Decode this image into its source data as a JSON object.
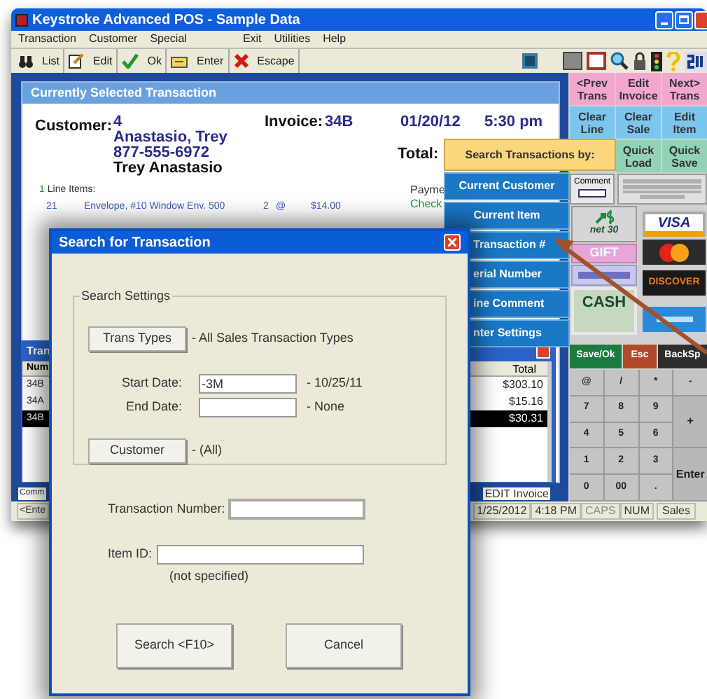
{
  "main_window": {
    "title": "Keystroke Advanced POS - Sample Data",
    "menu_left": [
      "Transaction",
      "Customer",
      "Special"
    ],
    "menu_right": [
      "Exit",
      "Utilities",
      "Help"
    ],
    "toolbar": [
      {
        "label": "List",
        "kind": "binoculars"
      },
      {
        "label": "Edit",
        "kind": "edit"
      },
      {
        "label": "Ok",
        "kind": "check"
      },
      {
        "label": "Enter",
        "kind": "enter"
      },
      {
        "label": "Escape",
        "kind": "cross"
      }
    ]
  },
  "current_transaction": {
    "title": "Currently Selected Transaction",
    "customer_label": "Customer:",
    "customer_number": "4",
    "customer_name": "Anastasio, Trey",
    "phone": "877-555-6972",
    "contact": "Trey Anastasio",
    "invoice_label": "Invoice:",
    "invoice": "34B",
    "date": "01/20/12",
    "time": "5:30 pm",
    "total_label": "Total:",
    "line_items_count": "1",
    "line_items_label": "Line Items:",
    "line_items": [
      {
        "item_id": "21",
        "description": "Envelope, #10 Window Env. 500",
        "qty": "2",
        "at": "@",
        "price": "$14.00"
      }
    ],
    "payment_label": "Payme",
    "payment": "Check"
  },
  "transactions_list": {
    "title": "Tran",
    "columns": [
      "Num",
      "Total"
    ],
    "rows": [
      {
        "num": "34B",
        "total": "$303.10",
        "selected": false
      },
      {
        "num": "34A",
        "total": "$15.16",
        "selected": false
      },
      {
        "num": "34B",
        "total": "$30.31",
        "selected": true
      }
    ]
  },
  "tabs": [
    "Comm",
    "EDIT Invoice"
  ],
  "status_bar": [
    {
      "text": "<Ente",
      "active": true
    },
    {
      "text": "1/25/2012",
      "active": true
    },
    {
      "text": "4:18 PM",
      "active": true
    },
    {
      "text": "CAPS",
      "active": false
    },
    {
      "text": "NUM",
      "active": true
    },
    {
      "text": "Sales",
      "active": true
    }
  ],
  "function_rows": [
    [
      {
        "label": "<Prev Trans",
        "color": "#f2a7cf"
      },
      {
        "label": "Edit Invoice",
        "color": "#f2a7cf"
      },
      {
        "label": "Next> Trans",
        "color": "#f2a7cf"
      }
    ],
    [
      {
        "label": "Clear Line",
        "color": "#7cc6ee"
      },
      {
        "label": "Clear Sale",
        "color": "#7cc6ee"
      },
      {
        "label": "Edit Item",
        "color": "#7cc6ee"
      }
    ],
    [
      {
        "label": "Quick Load",
        "color": "#93d3b5"
      },
      {
        "label": "Quick Save",
        "color": "#93d3b5"
      }
    ]
  ],
  "comment_button": "Comment",
  "payment_buttons": [
    {
      "kind": "terms",
      "label": "net 30"
    },
    {
      "kind": "visa",
      "label": "VISA"
    },
    {
      "kind": "gift",
      "label": "GIFT"
    },
    {
      "kind": "mastercard"
    },
    {
      "kind": "check"
    },
    {
      "kind": "discover",
      "label": "DISCOVER"
    },
    {
      "kind": "cash",
      "label": "CASH"
    },
    {
      "kind": "amex"
    }
  ],
  "action_keys": [
    {
      "label": "Save/Ok",
      "color": "#1d7a3e"
    },
    {
      "label": "Esc",
      "color": "#b3492b"
    },
    {
      "label": "BackSp",
      "color": "#2e2e2e"
    }
  ],
  "keypad": [
    {
      "label": "@",
      "kind": "key"
    },
    {
      "label": "/",
      "kind": "key"
    },
    {
      "label": "*",
      "kind": "key"
    },
    {
      "label": "-",
      "kind": "key"
    },
    {
      "label": "7",
      "kind": "key"
    },
    {
      "label": "8",
      "kind": "key"
    },
    {
      "label": "9",
      "kind": "key"
    },
    {
      "label": "+",
      "kind": "tall"
    },
    {
      "label": "4",
      "kind": "key"
    },
    {
      "label": "5",
      "kind": "key"
    },
    {
      "label": "6",
      "kind": "key"
    },
    {
      "label": "1",
      "kind": "key"
    },
    {
      "label": "2",
      "kind": "key"
    },
    {
      "label": "3",
      "kind": "key"
    },
    {
      "label": "Enter",
      "kind": "tall"
    },
    {
      "label": "0",
      "kind": "key"
    },
    {
      "label": "00",
      "kind": "key"
    },
    {
      "label": ".",
      "kind": "key"
    }
  ],
  "search_popup": {
    "header": "Search Transactions by:",
    "items": [
      {
        "label": "Current Customer",
        "kind": "full"
      },
      {
        "label": "Current Item",
        "kind": "full"
      },
      {
        "label": "Transaction #",
        "kind": "clipped"
      },
      {
        "label": "erial Number",
        "kind": "clipped"
      },
      {
        "label": "ine Comment",
        "kind": "clipped"
      },
      {
        "label": "nter Settings",
        "kind": "clipped"
      }
    ]
  },
  "dialog": {
    "title": "Search for Transaction",
    "group_label": "Search Settings",
    "trans_types_button": "Trans Types",
    "trans_types_value": "- All Sales Transaction Types",
    "start_date_label": "Start Date:",
    "start_date": "-3M",
    "start_date_note": "- 10/25/11",
    "end_date_label": "End Date:",
    "end_date_note": "- None",
    "customer_button": "Customer",
    "customer_value": "- (All)",
    "transaction_number_label": "Transaction Number:",
    "item_id_label": "Item ID:",
    "item_id_note": "(not specified)",
    "buttons": [
      "Search <F10>",
      "Cancel"
    ]
  }
}
